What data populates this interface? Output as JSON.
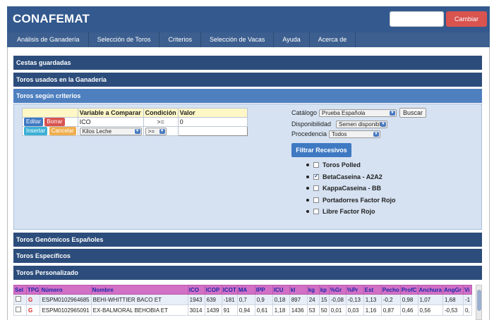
{
  "header": {
    "title": "CONAFEMAT",
    "password_value": "",
    "change_label": "Cambiar"
  },
  "nav": {
    "items": [
      "Análisis de Ganadería",
      "Selección de Toros",
      "Criterios",
      "Selección de Vacas",
      "Ayuda",
      "Acerca de"
    ]
  },
  "sections": {
    "cestas": "Cestas guardadas",
    "usados": "Toros usados en la Ganadería",
    "criterios": "Toros según criterios",
    "genomicos": "Toros Genómicos Españoles",
    "especificos": "Toros Específicos",
    "personalizado": "Toros Personalizado"
  },
  "criteria_table": {
    "headers": [
      "Variable a Comparar",
      "Condición",
      "Valor"
    ],
    "row": {
      "edit": "Editar",
      "delete": "Borrar",
      "variable": "ICO",
      "condition": ">=",
      "value": "0"
    },
    "new_row": {
      "insert": "Insertar",
      "cancel": "Cancelar",
      "variable": "Kilos Leche",
      "condition": ">=",
      "value": ""
    }
  },
  "filters": {
    "catalogo_label": "Catálogo",
    "catalogo_value": "Prueba Española",
    "buscar_label": "Buscar",
    "disponibilidad_label": "Disponibilidad",
    "disponibilidad_value": "Semen disponible",
    "procedencia_label": "Procedencia",
    "procedencia_value": "Todos",
    "filtrar_label": "Filtrar Recesivos",
    "checks": [
      {
        "label": "Toros Polled",
        "checked": false
      },
      {
        "label": "BetaCaseina - A2A2",
        "checked": true
      },
      {
        "label": "KappaCaseina - BB",
        "checked": false
      },
      {
        "label": "Portadorres Factor Rojo",
        "checked": false
      },
      {
        "label": "Libre Factor Rojo",
        "checked": false
      }
    ]
  },
  "results": {
    "columns": [
      "Sel",
      "TPG",
      "Número",
      "Nombre",
      "ICO",
      "ICOP",
      "ICOT",
      "MA",
      "IPP",
      "ICU",
      "kl",
      "kg",
      "kp",
      "%Gr",
      "%Pr",
      "Est",
      "Pecho",
      "ProfC",
      "Anchura",
      "AngGr",
      "Vi"
    ],
    "rows": [
      [
        "",
        "G",
        "ESPM0102964685",
        "BEHI-WHITTIER BACO ET",
        "1943",
        "639",
        "-181",
        "0,7",
        "0,9",
        "0,18",
        "897",
        "24",
        "15",
        "-0,08",
        "-0,13",
        "1,13",
        "-0,2",
        "0,98",
        "1,07",
        "1,68",
        "-1"
      ],
      [
        "",
        "G",
        "ESPM0102965091",
        "EX-BALMORAL BEHOBIA ET",
        "3014",
        "1439",
        "91",
        "0,94",
        "0,61",
        "1,18",
        "1436",
        "53",
        "50",
        "0,01",
        "0,03",
        "1,16",
        "0,87",
        "0,46",
        "0,56",
        "-0,53",
        "0,"
      ]
    ]
  }
}
